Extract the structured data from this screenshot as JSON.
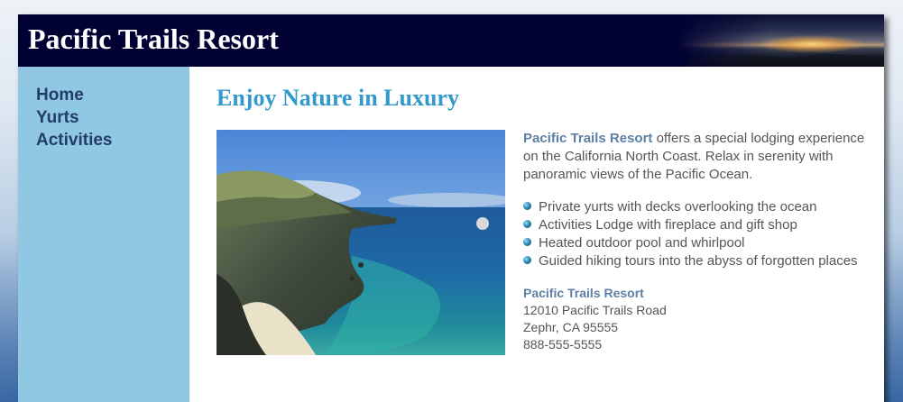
{
  "header": {
    "title": "Pacific Trails Resort"
  },
  "nav": {
    "items": [
      {
        "label": "Home"
      },
      {
        "label": "Yurts"
      },
      {
        "label": "Activities"
      }
    ]
  },
  "main": {
    "heading": "Enjoy Nature in Luxury",
    "intro_name": "Pacific Trails Resort",
    "intro_text": " offers a special lodging experience on the California North Coast. Relax in serenity with panoramic views of the Pacific Ocean.",
    "features": [
      "Private yurts with decks overlooking the ocean",
      "Activities Lodge with fireplace and gift shop",
      "Heated outdoor pool and whirlpool",
      "Guided hiking tours into the abyss of forgotten places"
    ],
    "contact": {
      "name": "Pacific Trails Resort",
      "street": "12010 Pacific Trails Road",
      "city": "Zephr, CA 95555",
      "phone": "888-555-5555"
    }
  },
  "colors": {
    "header_bg": "#000033",
    "nav_bg": "#90c7e3",
    "nav_link": "#223d68",
    "heading": "#3399cc",
    "resort_name": "#5c7fa3",
    "body_text": "#555555"
  }
}
